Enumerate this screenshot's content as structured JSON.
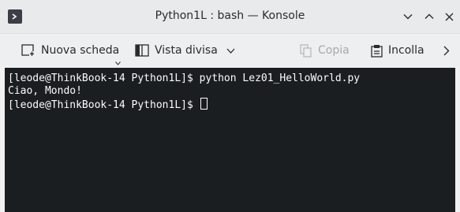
{
  "window": {
    "title": "Python1L : bash — Konsole"
  },
  "toolbar": {
    "new_tab_label": "Nuova scheda",
    "split_view_label": "Vista divisa",
    "copy_label": "Copia",
    "paste_label": "Incolla"
  },
  "terminal": {
    "lines": [
      "[leode@ThinkBook-14 Python1L]$ python Lez01_HelloWorld.py",
      "Ciao, Mondo!",
      "[leode@ThinkBook-14 Python1L]$ "
    ]
  },
  "colors": {
    "terminal_bg": "#1b1e20",
    "terminal_fg": "#fcfcfc",
    "titlebar_bg": "#e9eaeb"
  },
  "icons": [
    "konsole-app-icon",
    "minimize-icon",
    "maximize-icon",
    "close-icon",
    "new-tab-icon",
    "split-view-icon",
    "chevron-down-icon",
    "copy-icon",
    "paste-icon",
    "chevron-right-icon"
  ]
}
